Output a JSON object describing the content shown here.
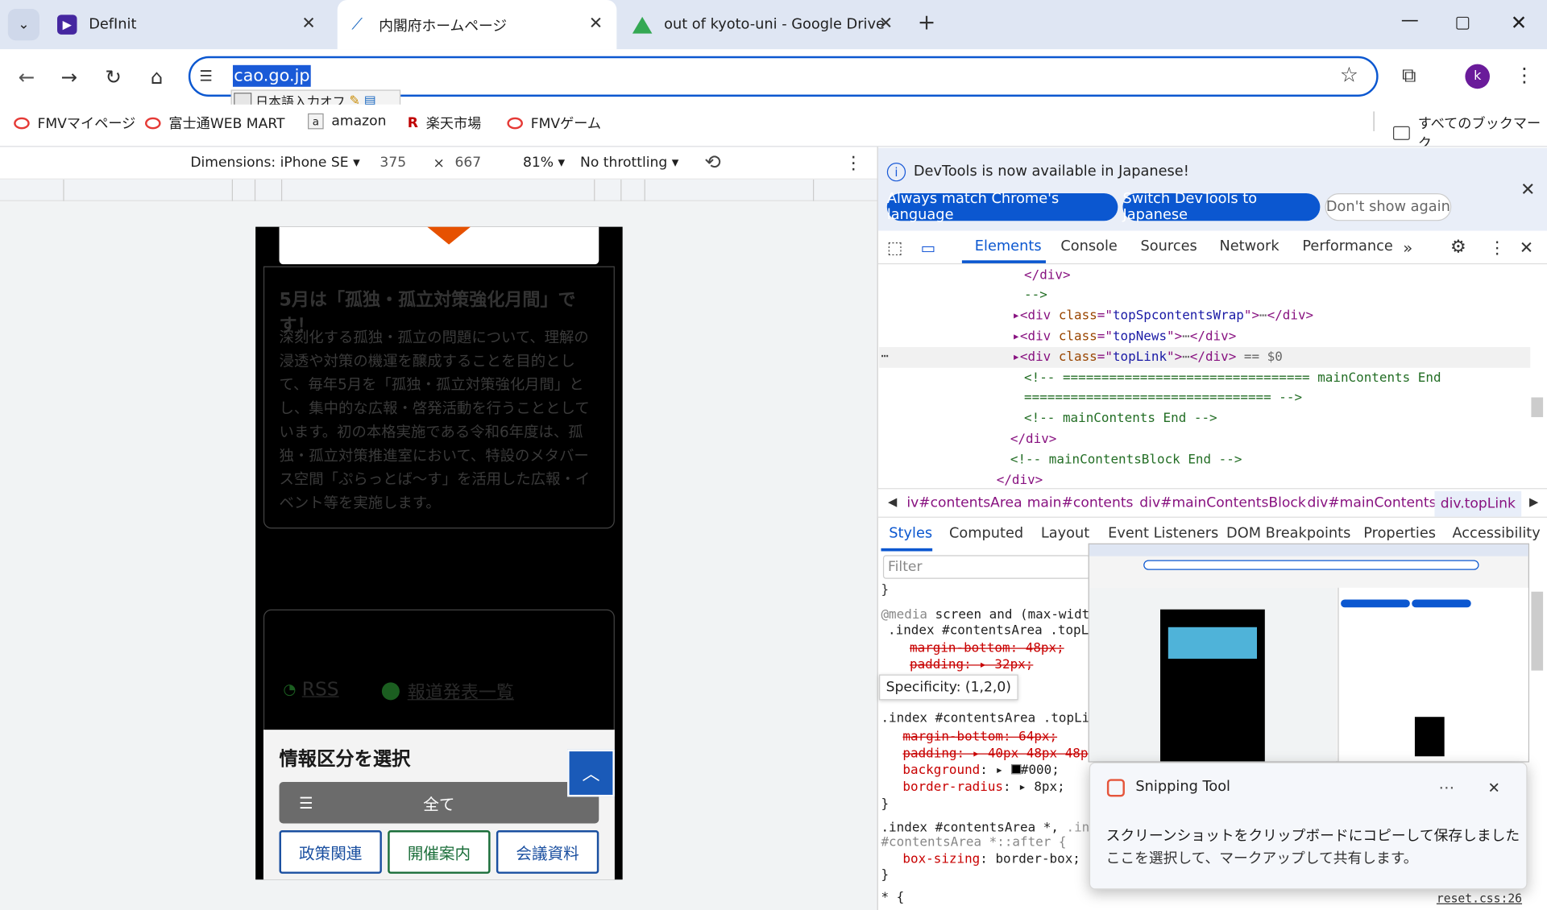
{
  "tabs": [
    {
      "title": "DefInit",
      "icon": "definit-icon"
    },
    {
      "title": "内閣府ホームページ",
      "icon": "cao-icon"
    },
    {
      "title": "out of kyoto-uni - Google Drive",
      "icon": "drive-icon"
    }
  ],
  "address": {
    "url": "cao.go.jp"
  },
  "ime": {
    "label": "日本語入力オフ"
  },
  "profile": {
    "initial": "k",
    "color": "#6a1b9a"
  },
  "bookmarks": [
    "FMVマイページ",
    "富士通WEB MART",
    "amazon",
    "楽天市場",
    "FMVゲーム"
  ],
  "all_bookmarks": "すべてのブックマーク",
  "device_toolbar": {
    "dimensions": "Dimensions: iPhone SE",
    "width": "375",
    "x": "×",
    "height": "667",
    "zoom": "81%",
    "throttling": "No throttling"
  },
  "page": {
    "heading": "5月は「孤独・孤立対策強化月間」です！",
    "body": "深刻化する孤独・孤立の問題について、理解の浸透や対策の機運を醸成することを目的として、毎年5月を「孤独・孤立対策強化月間」とし、集中的な広報・啓発活動を行うこととしています。初の本格実施である令和6年度は、孤独・孤立対策推進室において、特設のメタバース空間「ぷらっとば～す」を活用した広報・イベント等を実施します。",
    "rss": "RSS",
    "press_list": "報道発表一覧",
    "select_title": "情報区分を選択",
    "all": "全て",
    "buttons": [
      "政策関連",
      "開催案内",
      "会議資料"
    ]
  },
  "devtools": {
    "notice": "DevTools is now available in Japanese!",
    "btn_match": "Always match Chrome's language",
    "btn_switch": "Switch DevTools to Japanese",
    "btn_dont": "Don't show again",
    "tabs": [
      "Elements",
      "Console",
      "Sources",
      "Network",
      "Performance"
    ],
    "dom": [
      {
        "text": "</div>"
      },
      {
        "text": "-->"
      },
      {
        "text": "topSpcontentsWrap"
      },
      {
        "text": "topNews"
      },
      {
        "text": "topLink"
      },
      {
        "text": "<!-- ================================ mainContents End"
      },
      {
        "text": "================================ -->"
      },
      {
        "text": "<!-- mainContents End -->"
      },
      {
        "text": "</div>"
      },
      {
        "text": "<!-- mainContentsBlock End -->"
      },
      {
        "text": "</div>"
      }
    ],
    "crumbs": [
      "iv#contentsArea",
      "main#contents",
      "div#mainContentsBlock",
      "div#mainContents",
      "div.topLink"
    ],
    "subtabs": [
      "Styles",
      "Computed",
      "Layout",
      "Event Listeners",
      "DOM Breakpoints",
      "Properties",
      "Accessibility"
    ],
    "filter": "Filter",
    "specificity": "Specificity: (1,2,0)",
    "reset": "reset.css:26"
  },
  "snipping": {
    "title": "Snipping Tool",
    "line1": "スクリーンショットをクリップボードにコピーして保存しました",
    "line2": "ここを選択して、マークアップして共有します。"
  }
}
